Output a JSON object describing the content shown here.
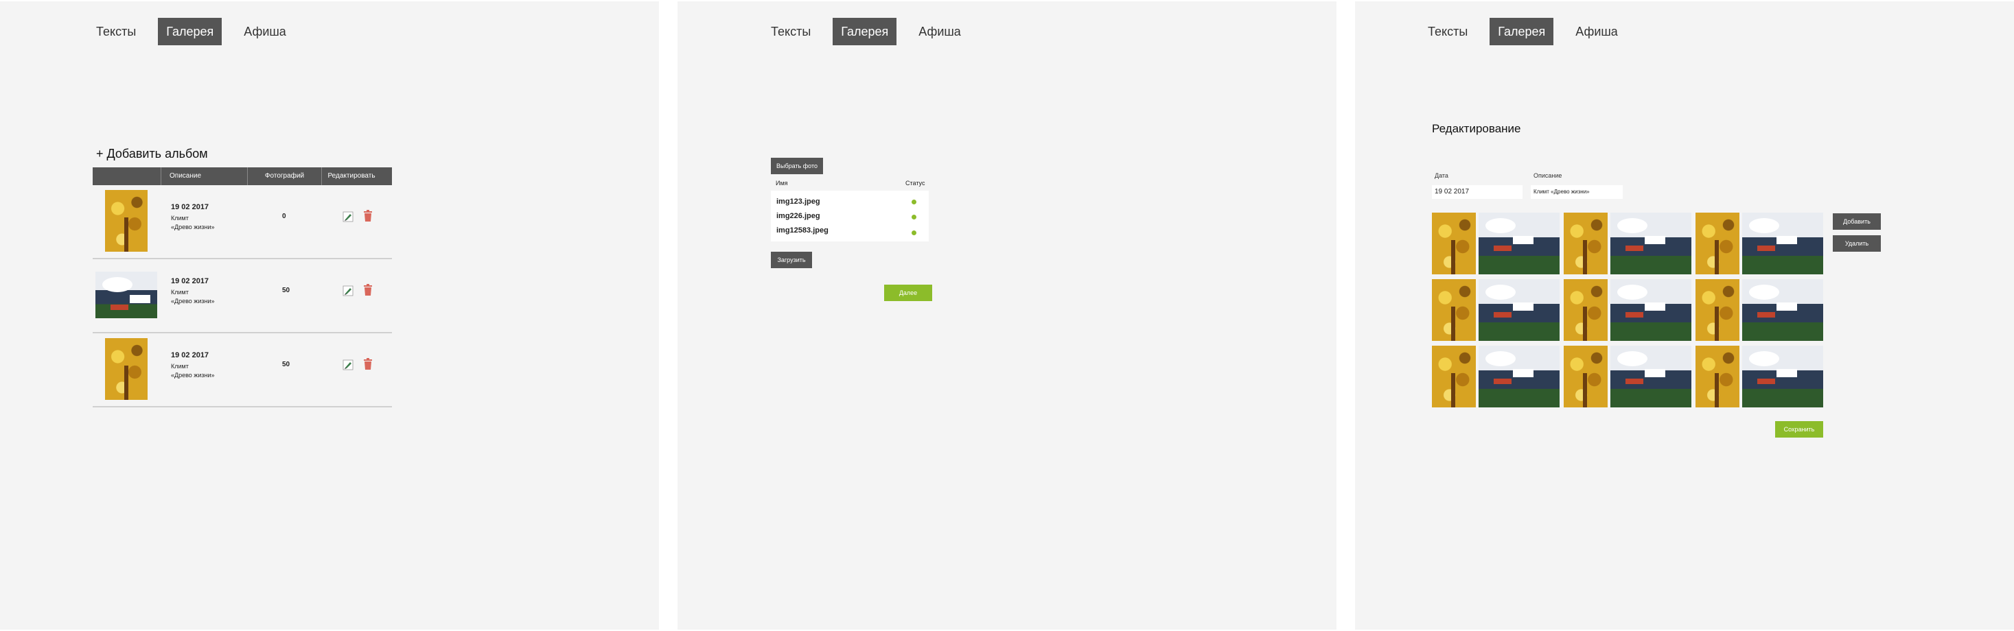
{
  "nav": {
    "tabs": [
      "Тексты",
      "Галерея",
      "Афиша"
    ],
    "active": 1
  },
  "list_screen": {
    "add_album_label": "+ Добавить альбом",
    "columns": [
      "",
      "Описание",
      "Фотографий",
      "Редактировать"
    ],
    "rows": [
      {
        "date": "19 02 2017",
        "author": "Климт",
        "title": "«Древо жизни»",
        "count": "0",
        "thumb": "tree"
      },
      {
        "date": "19 02 2017",
        "author": "Климт",
        "title": "«Древо жизни»",
        "count": "50",
        "thumb": "landscape"
      },
      {
        "date": "19 02 2017",
        "author": "Климт",
        "title": "«Древо жизни»",
        "count": "50",
        "thumb": "tree"
      }
    ]
  },
  "upload_screen": {
    "choose_photo_label": "Выбрать фото",
    "name_header": "Имя",
    "status_header": "Статус",
    "files": [
      "img123.jpeg",
      "img226.jpeg",
      "img12583.jpeg"
    ],
    "upload_label": "Загрузить",
    "next_label": "Далее"
  },
  "edit_screen": {
    "title": "Редактирование",
    "date_label": "Дата",
    "date_value": "19 02 2017",
    "desc_label": "Описание",
    "desc_value": "Климт «Древо жизни»",
    "add_label": "Добавить",
    "delete_label": "Удалить",
    "save_label": "Сохранить",
    "grid": [
      [
        "tree",
        "landscape",
        "tree",
        "landscape",
        "tree",
        "landscape"
      ],
      [
        "tree",
        "landscape",
        "tree",
        "landscape",
        "tree",
        "landscape"
      ],
      [
        "tree",
        "landscape",
        "tree",
        "landscape",
        "tree",
        "landscape"
      ]
    ]
  },
  "colors": {
    "accent": "#8cbc2a",
    "dark": "#555555",
    "panel": "#f4f4f4",
    "edit_icon": "#3a7d4a",
    "delete_icon": "#d9675b"
  },
  "icons": {
    "edit": "pencil-icon",
    "delete": "trash-icon"
  }
}
